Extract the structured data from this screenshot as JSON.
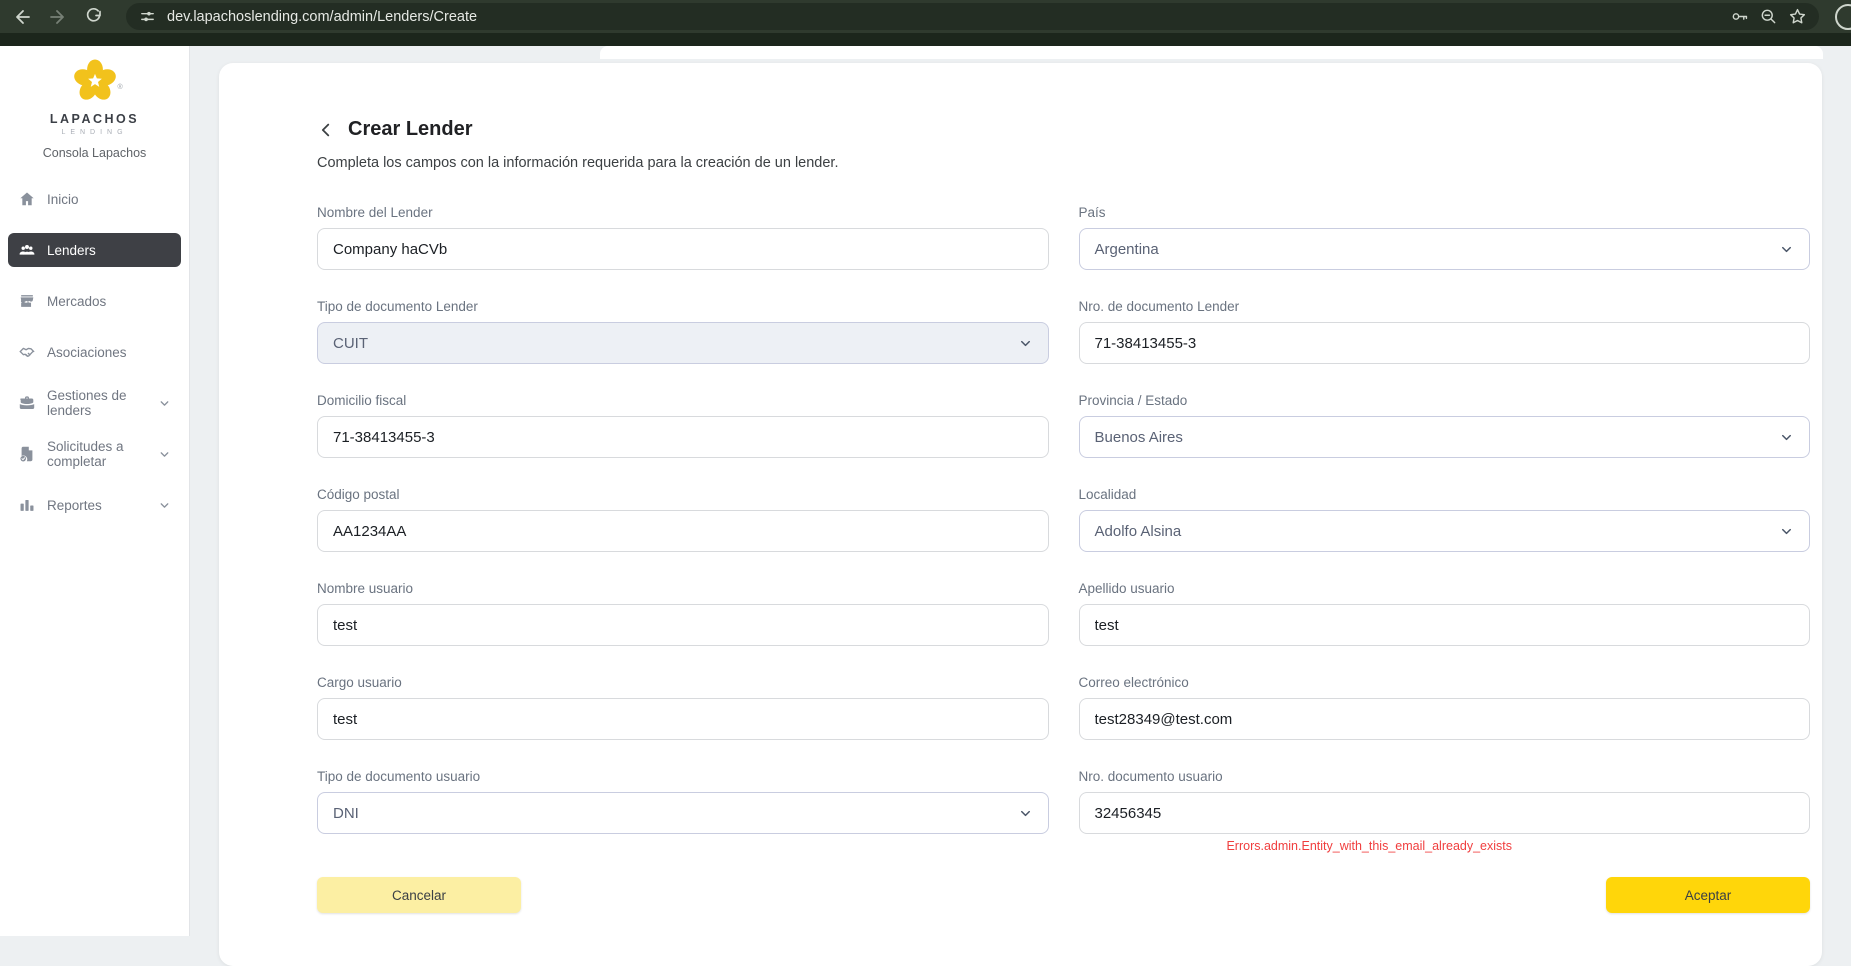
{
  "browser": {
    "url": "dev.lapachoslending.com/admin/Lenders/Create",
    "icons": [
      "back-icon",
      "forward-icon",
      "reload-icon",
      "site-info-icon",
      "password-key-icon",
      "zoom-out-icon",
      "bookmark-star-icon",
      "profile-avatar"
    ]
  },
  "sidebar": {
    "logo_title": "LAPACHOS",
    "logo_subtitle": "LENDING",
    "registered_mark": "®",
    "console_label": "Consola Lapachos",
    "items": [
      {
        "label": "Inicio",
        "icon": "home-icon",
        "active": false,
        "has_chevron": false
      },
      {
        "label": "Lenders",
        "icon": "users-group-icon",
        "active": true,
        "has_chevron": false
      },
      {
        "label": "Mercados",
        "icon": "store-icon",
        "active": false,
        "has_chevron": false
      },
      {
        "label": "Asociaciones",
        "icon": "handshake-icon",
        "active": false,
        "has_chevron": false
      },
      {
        "label": "Gestiones de lenders",
        "icon": "briefcase-icon",
        "active": false,
        "has_chevron": true
      },
      {
        "label": "Solicitudes a completar",
        "icon": "document-check-icon",
        "active": false,
        "has_chevron": true
      },
      {
        "label": "Reportes",
        "icon": "bar-chart-icon",
        "active": false,
        "has_chevron": true
      }
    ]
  },
  "page": {
    "title": "Crear Lender",
    "subtitle": "Completa los campos con la información requerida para la creación de un lender.",
    "fields": [
      {
        "label": "Nombre del Lender",
        "value": "Company haCVb",
        "type": "text"
      },
      {
        "label": "País",
        "value": "Argentina",
        "type": "select"
      },
      {
        "label": "Tipo de documento Lender",
        "value": "CUIT",
        "type": "select"
      },
      {
        "label": "Nro. de documento Lender",
        "value": "71-38413455-3",
        "type": "text"
      },
      {
        "label": "Domicilio fiscal",
        "value": "71-38413455-3",
        "type": "text"
      },
      {
        "label": "Provincia / Estado",
        "value": "Buenos Aires",
        "type": "select"
      },
      {
        "label": "Código postal",
        "value": "AA1234AA",
        "type": "text"
      },
      {
        "label": "Localidad",
        "value": "Adolfo Alsina",
        "type": "select"
      },
      {
        "label": "Nombre usuario",
        "value": "test",
        "type": "text"
      },
      {
        "label": "Apellido usuario",
        "value": "test",
        "type": "text"
      },
      {
        "label": "Cargo usuario",
        "value": "test",
        "type": "text"
      },
      {
        "label": "Correo electrónico",
        "value": "test28349@test.com",
        "type": "text"
      },
      {
        "label": "Tipo de documento usuario",
        "value": "DNI",
        "type": "select"
      },
      {
        "label": "Nro. documento usuario",
        "value": "32456345",
        "type": "text",
        "error": "Errors.admin.Entity_with_this_email_already_exists"
      }
    ],
    "actions": {
      "cancel_label": "Cancelar",
      "accept_label": "Aceptar"
    }
  },
  "colors": {
    "chrome_bg": "#2f3a2e",
    "url_pill_bg": "#232d23",
    "accent_yellow": "#ffd60a",
    "pale_yellow": "#fcefa3",
    "error_red": "#f03e3e",
    "active_item_bg": "#3e4045",
    "logo_gold": "#f2c21c"
  }
}
